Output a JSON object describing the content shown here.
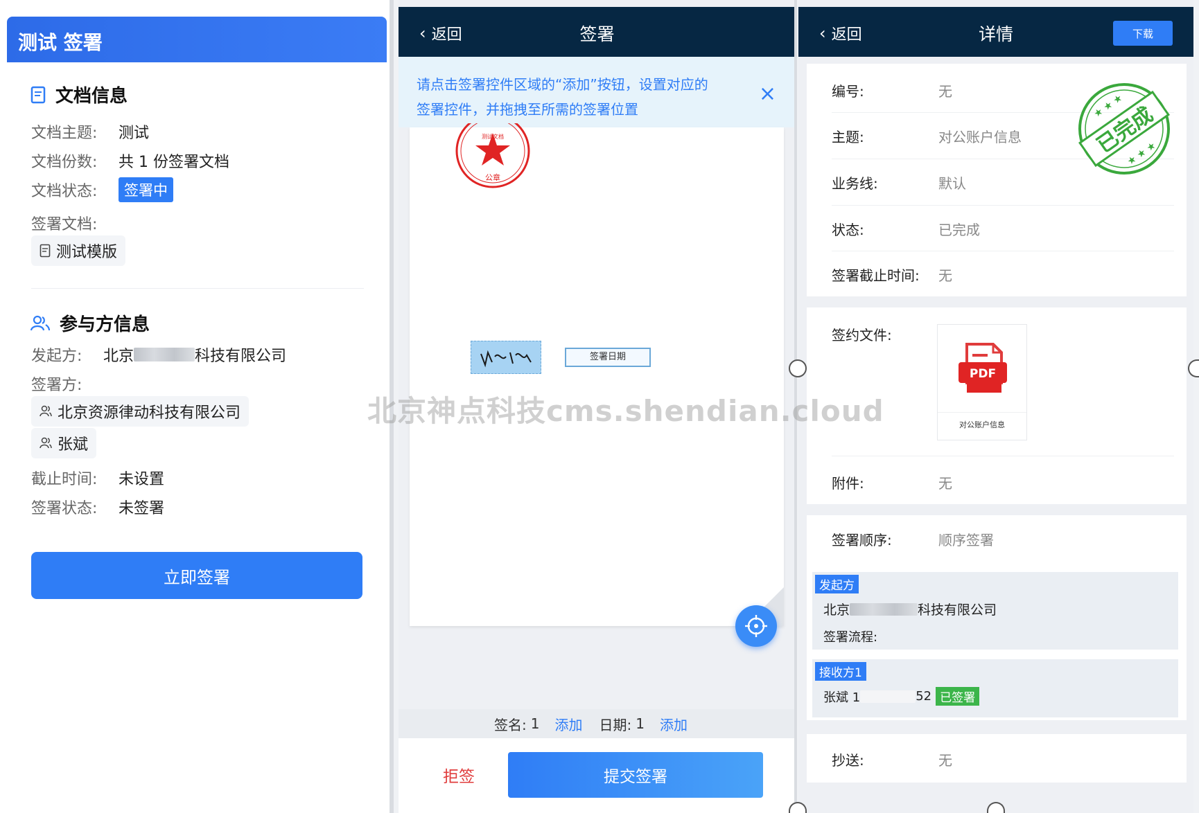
{
  "colors": {
    "primary": "#2f7df6",
    "nav_dark": "#062743",
    "danger": "#e03c3c",
    "success": "#3cb54a",
    "stamp_red": "#e02424",
    "stamp_green": "#3aa83c"
  },
  "panel1": {
    "title": "测试 签署",
    "doc_section": {
      "heading": "文档信息",
      "icon": "document-icon",
      "subject_label": "文档主题:",
      "subject_value": "测试",
      "count_label": "文档份数:",
      "count_value": "共 1 份签署文档",
      "status_label": "文档状态:",
      "status_value": "签署中",
      "file_label": "签署文档:",
      "file_chip": "测试模版"
    },
    "party_section": {
      "heading": "参与方信息",
      "icon": "users-icon",
      "initiator_label": "发起方:",
      "initiator_prefix": "北京",
      "initiator_suffix": "科技有限公司",
      "signers_label": "签署方:",
      "signers": [
        "北京资源律动科技有限公司",
        "张斌"
      ],
      "deadline_label": "截止时间:",
      "deadline_value": "未设置",
      "sign_status_label": "签署状态:",
      "sign_status_value": "未签署"
    },
    "sign_button": "立即签署"
  },
  "panel2": {
    "back": "返回",
    "title": "签署",
    "tip": "请点击签署控件区域的“添加”按钮，设置对应的签署控件，并拖拽至所需的签署位置",
    "seal_text": "测试文档",
    "seal_sub": "公章",
    "date_field": "签署日期",
    "sign_count_label": "签名:",
    "sign_count": "1",
    "add_label": "添加",
    "date_count_label": "日期:",
    "date_count": "1",
    "add_label2": "添加",
    "reject": "拒签",
    "submit": "提交签署"
  },
  "panel3": {
    "back": "返回",
    "title": "详情",
    "download": "下载",
    "stamp": "已完成",
    "number_label": "编号:",
    "number_value": "无",
    "subject_label": "主题:",
    "subject_value": "对公账户信息",
    "line_label": "业务线:",
    "line_value": "默认",
    "status_label": "状态:",
    "status_value": "已完成",
    "deadline_label": "签署截止时间:",
    "deadline_value": "无",
    "file_label": "签约文件:",
    "pdf_badge": "PDF",
    "pdf_name": "对公账户信息",
    "attach_label": "附件:",
    "attach_value": "无",
    "order_label": "签署顺序:",
    "order_value": "顺序签署",
    "initiator_tag": "发起方",
    "initiator_prefix": "北京",
    "initiator_suffix": "科技有限公司",
    "flow_label": "签署流程:",
    "receiver_tag": "接收方1",
    "receiver_name": "张斌 1",
    "receiver_phone_tail": "52",
    "signed_badge": "已签署",
    "cc_label": "抄送:",
    "cc_value": "无"
  },
  "watermark": "北京神点科技cms.shendian.cloud"
}
